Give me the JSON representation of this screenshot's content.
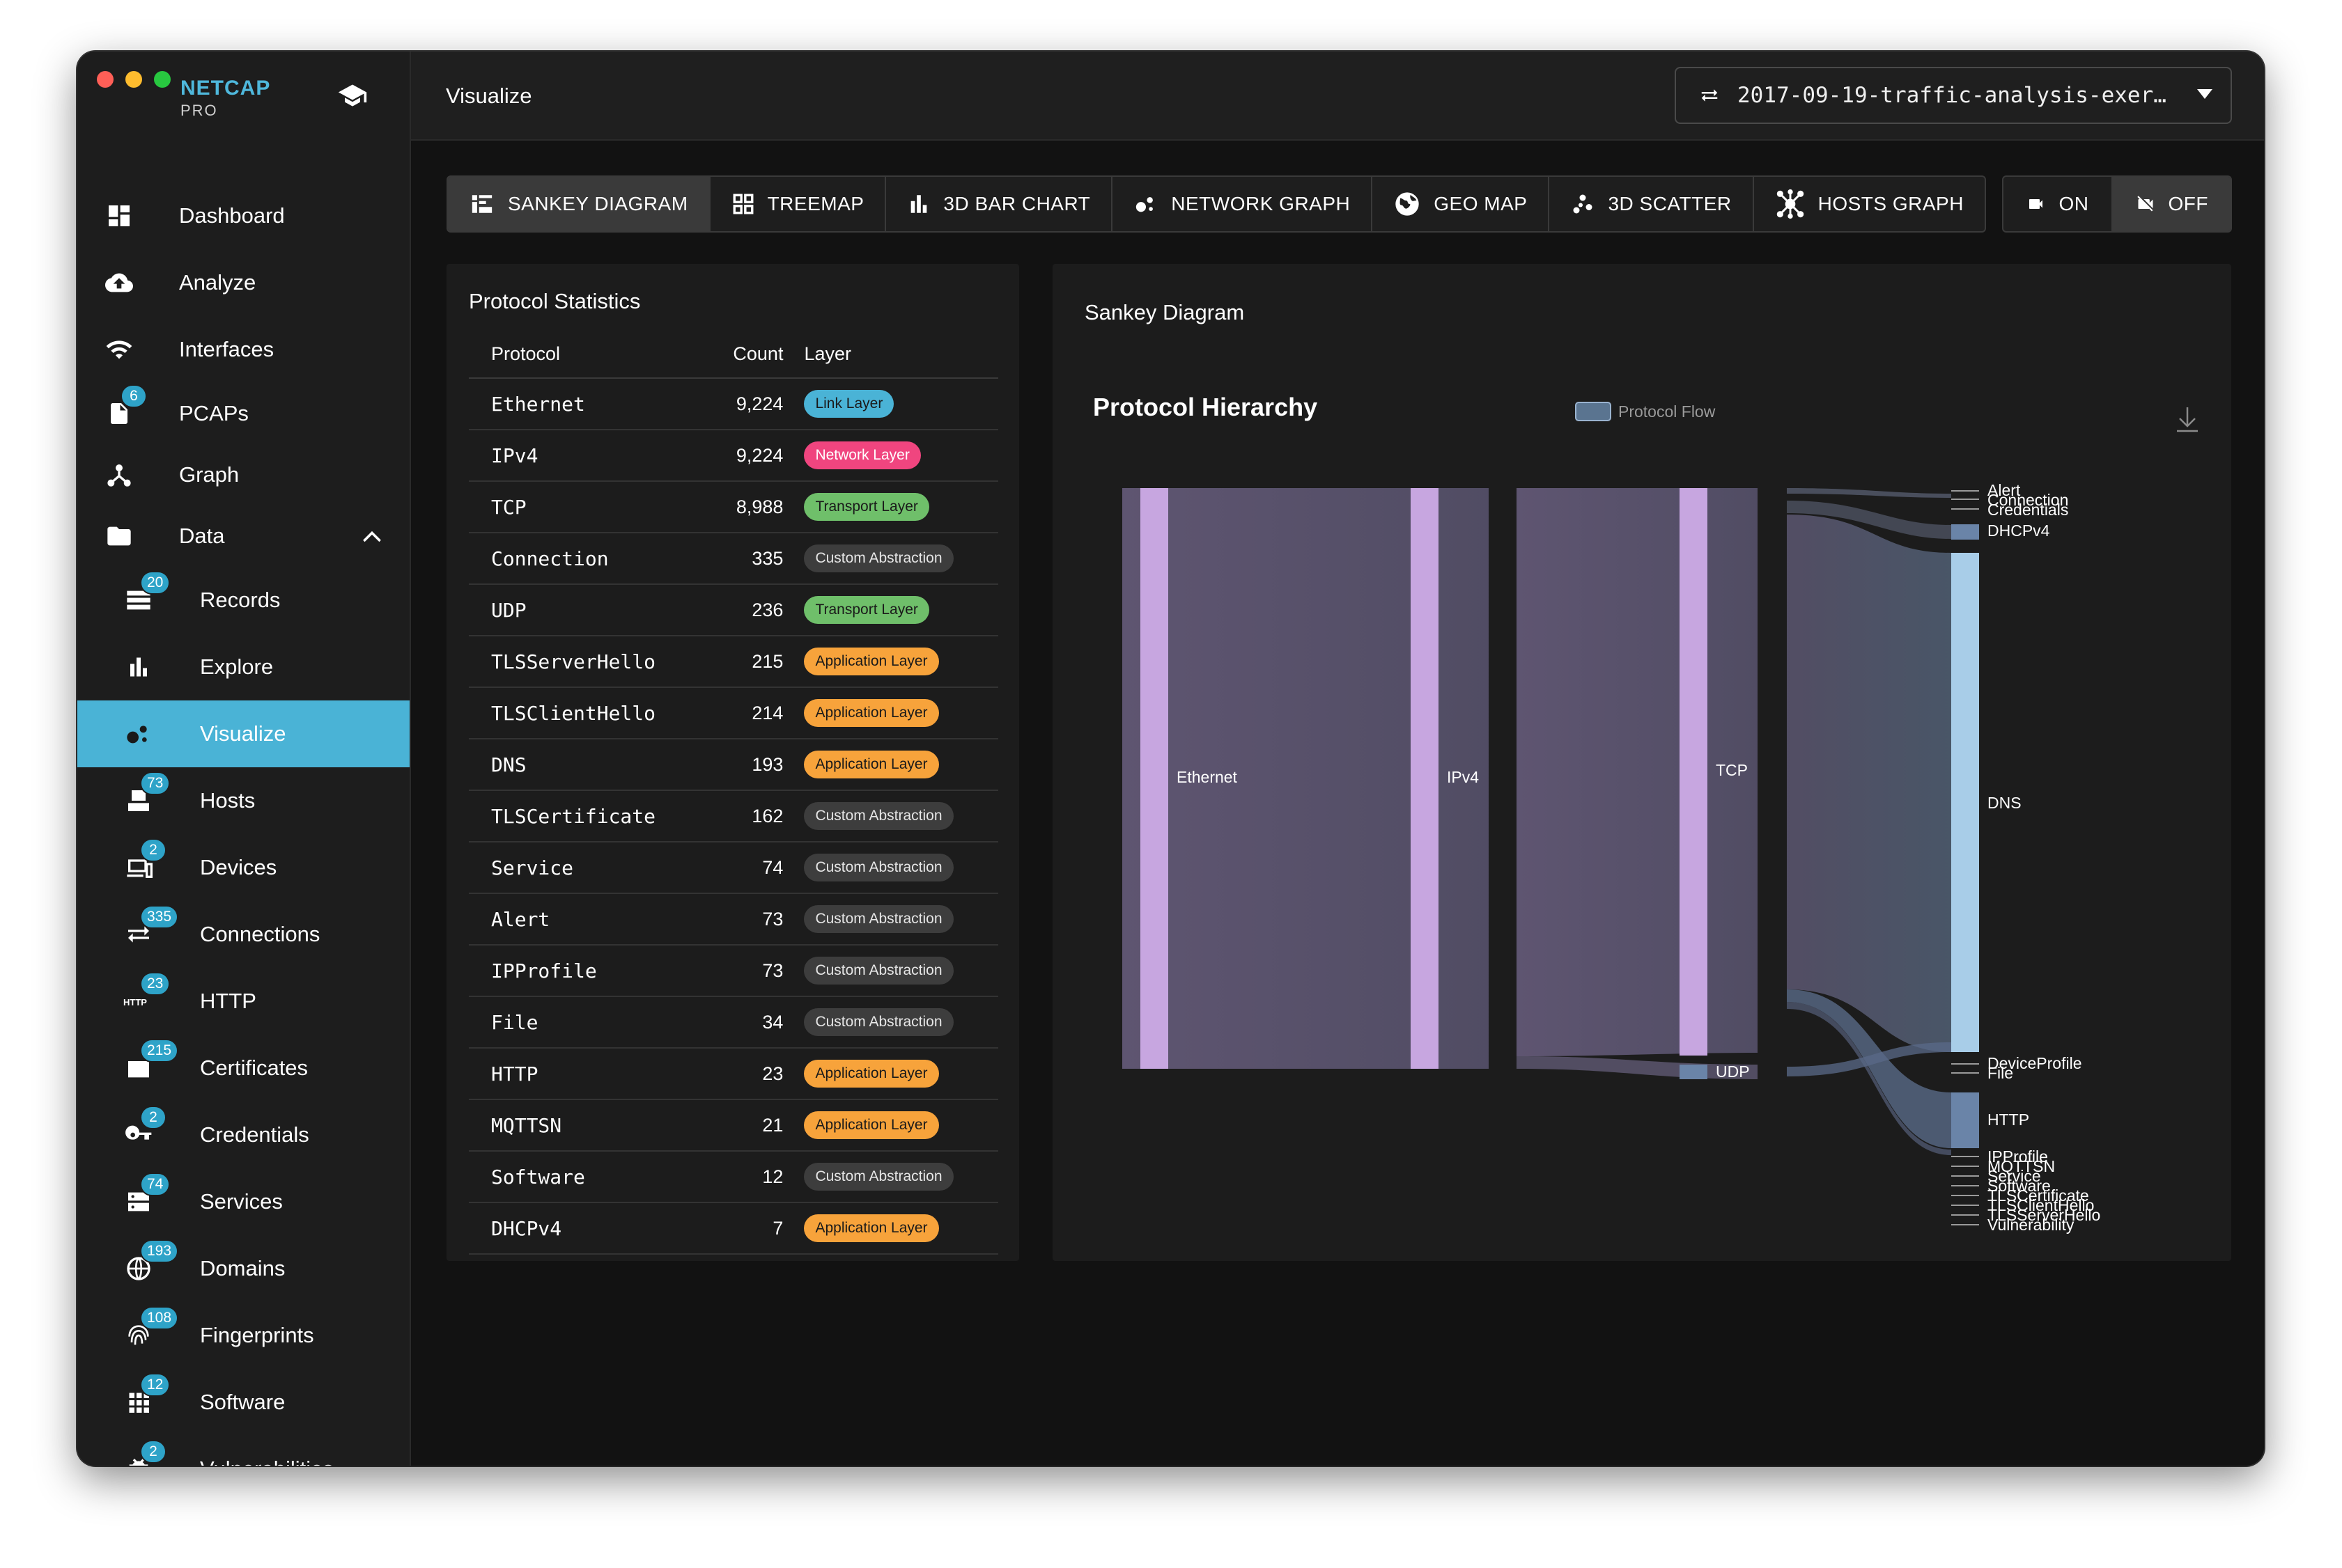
{
  "app": {
    "name": "NETCAP",
    "edition": "PRO"
  },
  "header": {
    "title": "Visualize",
    "file": "2017-09-19-traffic-analysis-exer…"
  },
  "sidebar": {
    "items": [
      {
        "label": "Dashboard"
      },
      {
        "label": "Analyze"
      },
      {
        "label": "Interfaces"
      },
      {
        "label": "PCAPs",
        "badge": "6"
      },
      {
        "label": "Graph"
      },
      {
        "label": "Data"
      }
    ],
    "sub_items": [
      {
        "label": "Records",
        "badge": "20"
      },
      {
        "label": "Explore"
      },
      {
        "label": "Visualize"
      },
      {
        "label": "Hosts",
        "badge": "73"
      },
      {
        "label": "Devices",
        "badge": "2"
      },
      {
        "label": "Connections",
        "badge": "335"
      },
      {
        "label": "HTTP",
        "badge": "23"
      },
      {
        "label": "Certificates",
        "badge": "215"
      },
      {
        "label": "Credentials",
        "badge": "2"
      },
      {
        "label": "Services",
        "badge": "74"
      },
      {
        "label": "Domains",
        "badge": "193"
      },
      {
        "label": "Fingerprints",
        "badge": "108"
      },
      {
        "label": "Software",
        "badge": "12"
      },
      {
        "label": "Vulnerabilities",
        "badge": "2"
      }
    ]
  },
  "tabs": [
    {
      "label": "SANKEY DIAGRAM"
    },
    {
      "label": "TREEMAP"
    },
    {
      "label": "3D BAR CHART"
    },
    {
      "label": "NETWORK GRAPH"
    },
    {
      "label": "GEO MAP"
    },
    {
      "label": "3D SCATTER"
    },
    {
      "label": "HOSTS GRAPH"
    }
  ],
  "toggle": {
    "on": "ON",
    "off": "OFF"
  },
  "stats": {
    "title": "Protocol Statistics",
    "columns": [
      "Protocol",
      "Count",
      "Layer"
    ],
    "rows": [
      {
        "protocol": "Ethernet",
        "count": "9,224",
        "layer": "Link Layer",
        "kind": "link"
      },
      {
        "protocol": "IPv4",
        "count": "9,224",
        "layer": "Network Layer",
        "kind": "network"
      },
      {
        "protocol": "TCP",
        "count": "8,988",
        "layer": "Transport Layer",
        "kind": "transport"
      },
      {
        "protocol": "Connection",
        "count": "335",
        "layer": "Custom Abstraction",
        "kind": "custom"
      },
      {
        "protocol": "UDP",
        "count": "236",
        "layer": "Transport Layer",
        "kind": "transport"
      },
      {
        "protocol": "TLSServerHello",
        "count": "215",
        "layer": "Application Layer",
        "kind": "app"
      },
      {
        "protocol": "TLSClientHello",
        "count": "214",
        "layer": "Application Layer",
        "kind": "app"
      },
      {
        "protocol": "DNS",
        "count": "193",
        "layer": "Application Layer",
        "kind": "app"
      },
      {
        "protocol": "TLSCertificate",
        "count": "162",
        "layer": "Custom Abstraction",
        "kind": "custom"
      },
      {
        "protocol": "Service",
        "count": "74",
        "layer": "Custom Abstraction",
        "kind": "custom"
      },
      {
        "protocol": "Alert",
        "count": "73",
        "layer": "Custom Abstraction",
        "kind": "custom"
      },
      {
        "protocol": "IPProfile",
        "count": "73",
        "layer": "Custom Abstraction",
        "kind": "custom"
      },
      {
        "protocol": "File",
        "count": "34",
        "layer": "Custom Abstraction",
        "kind": "custom"
      },
      {
        "protocol": "HTTP",
        "count": "23",
        "layer": "Application Layer",
        "kind": "app"
      },
      {
        "protocol": "MQTTSN",
        "count": "21",
        "layer": "Application Layer",
        "kind": "app"
      },
      {
        "protocol": "Software",
        "count": "12",
        "layer": "Custom Abstraction",
        "kind": "custom"
      },
      {
        "protocol": "DHCPv4",
        "count": "7",
        "layer": "Application Layer",
        "kind": "app"
      }
    ]
  },
  "sankey": {
    "panel_title": "Sankey Diagram",
    "chart_title": "Protocol Hierarchy",
    "legend": "Protocol Flow",
    "nodes": {
      "col1": [
        "Ethernet"
      ],
      "col2": [
        "IPv4"
      ],
      "col3": [
        "TCP",
        "UDP"
      ],
      "col4": [
        "Alert",
        "Connection",
        "Credentials",
        "DHCPv4",
        "DNS",
        "DeviceProfile",
        "File",
        "HTTP",
        "IPProfile",
        "MQTTSN",
        "Service",
        "Software",
        "TLSCertificate",
        "TLSClientHello",
        "TLSServerHello",
        "Vulnerability"
      ]
    }
  },
  "colors": {
    "accent": "#4ab3d6",
    "link_layer": "#4ab3d6",
    "network_layer": "#f0457f",
    "transport_layer": "#6fbf6a",
    "application_layer": "#f7a33b",
    "custom_abstraction": "#3d3d3d",
    "sankey_node_lavender": "#c7a6e0",
    "sankey_node_blue": "#a8cde8"
  }
}
